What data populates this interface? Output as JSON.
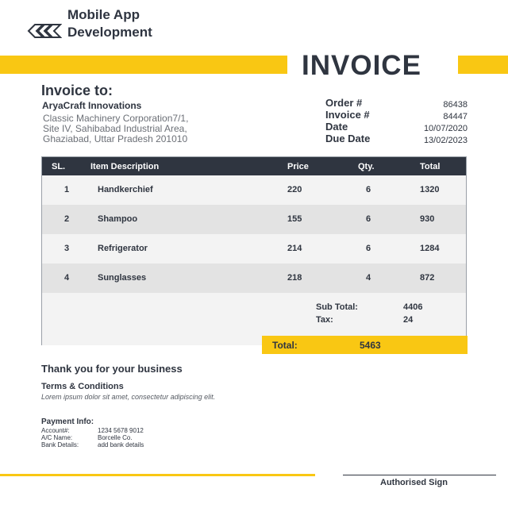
{
  "brand": {
    "line1": "Mobile App",
    "line2": "Development",
    "logo_icon": "interlocked-diamond-logo"
  },
  "title": "INVOICE",
  "bill_to": {
    "heading": "Invoice to:",
    "company": "AryaCraft Innovations",
    "address_lines": [
      "Classic Machinery Corporation7/1,",
      "Site IV, Sahibabad Industrial Area,",
      "Ghaziabad, Uttar Pradesh 201010"
    ]
  },
  "meta": [
    {
      "label": "Order #",
      "value": "86438"
    },
    {
      "label": "Invoice #",
      "value": "84447"
    },
    {
      "label": "Date",
      "value": "10/07/2020"
    },
    {
      "label": "Due Date",
      "value": "13/02/2023"
    }
  ],
  "table": {
    "headers": [
      "SL.",
      "Item Description",
      "Price",
      "Qty.",
      "Total"
    ],
    "rows": [
      {
        "sl": "1",
        "item": "Handkerchief",
        "price": "220",
        "qty": "6",
        "total": "1320"
      },
      {
        "sl": "2",
        "item": "Shampoo",
        "price": "155",
        "qty": "6",
        "total": "930"
      },
      {
        "sl": "3",
        "item": "Refrigerator",
        "price": "214",
        "qty": "6",
        "total": "1284"
      },
      {
        "sl": "4",
        "item": "Sunglasses",
        "price": "218",
        "qty": "4",
        "total": "872"
      }
    ]
  },
  "summary": {
    "subtotal_label": "Sub Total:",
    "subtotal_value": "4406",
    "tax_label": "Tax:",
    "tax_value": "24",
    "total_label": "Total:",
    "total_value": "5463"
  },
  "thanks": "Thank you for your business",
  "terms": {
    "title": "Terms & Conditions",
    "text": "Lorem ipsum dolor sit amet, consectetur adipiscing elit."
  },
  "payment": {
    "title": "Payment Info:",
    "rows": [
      {
        "label": "Account#:",
        "value": "1234 5678 9012"
      },
      {
        "label": "A/C Name:",
        "value": "Borcelle Co."
      },
      {
        "label": "Bank Details:",
        "value": "add bank details"
      }
    ]
  },
  "signature_label": "Authorised Sign",
  "colors": {
    "accent": "#f9c713",
    "dark": "#2f3540"
  }
}
